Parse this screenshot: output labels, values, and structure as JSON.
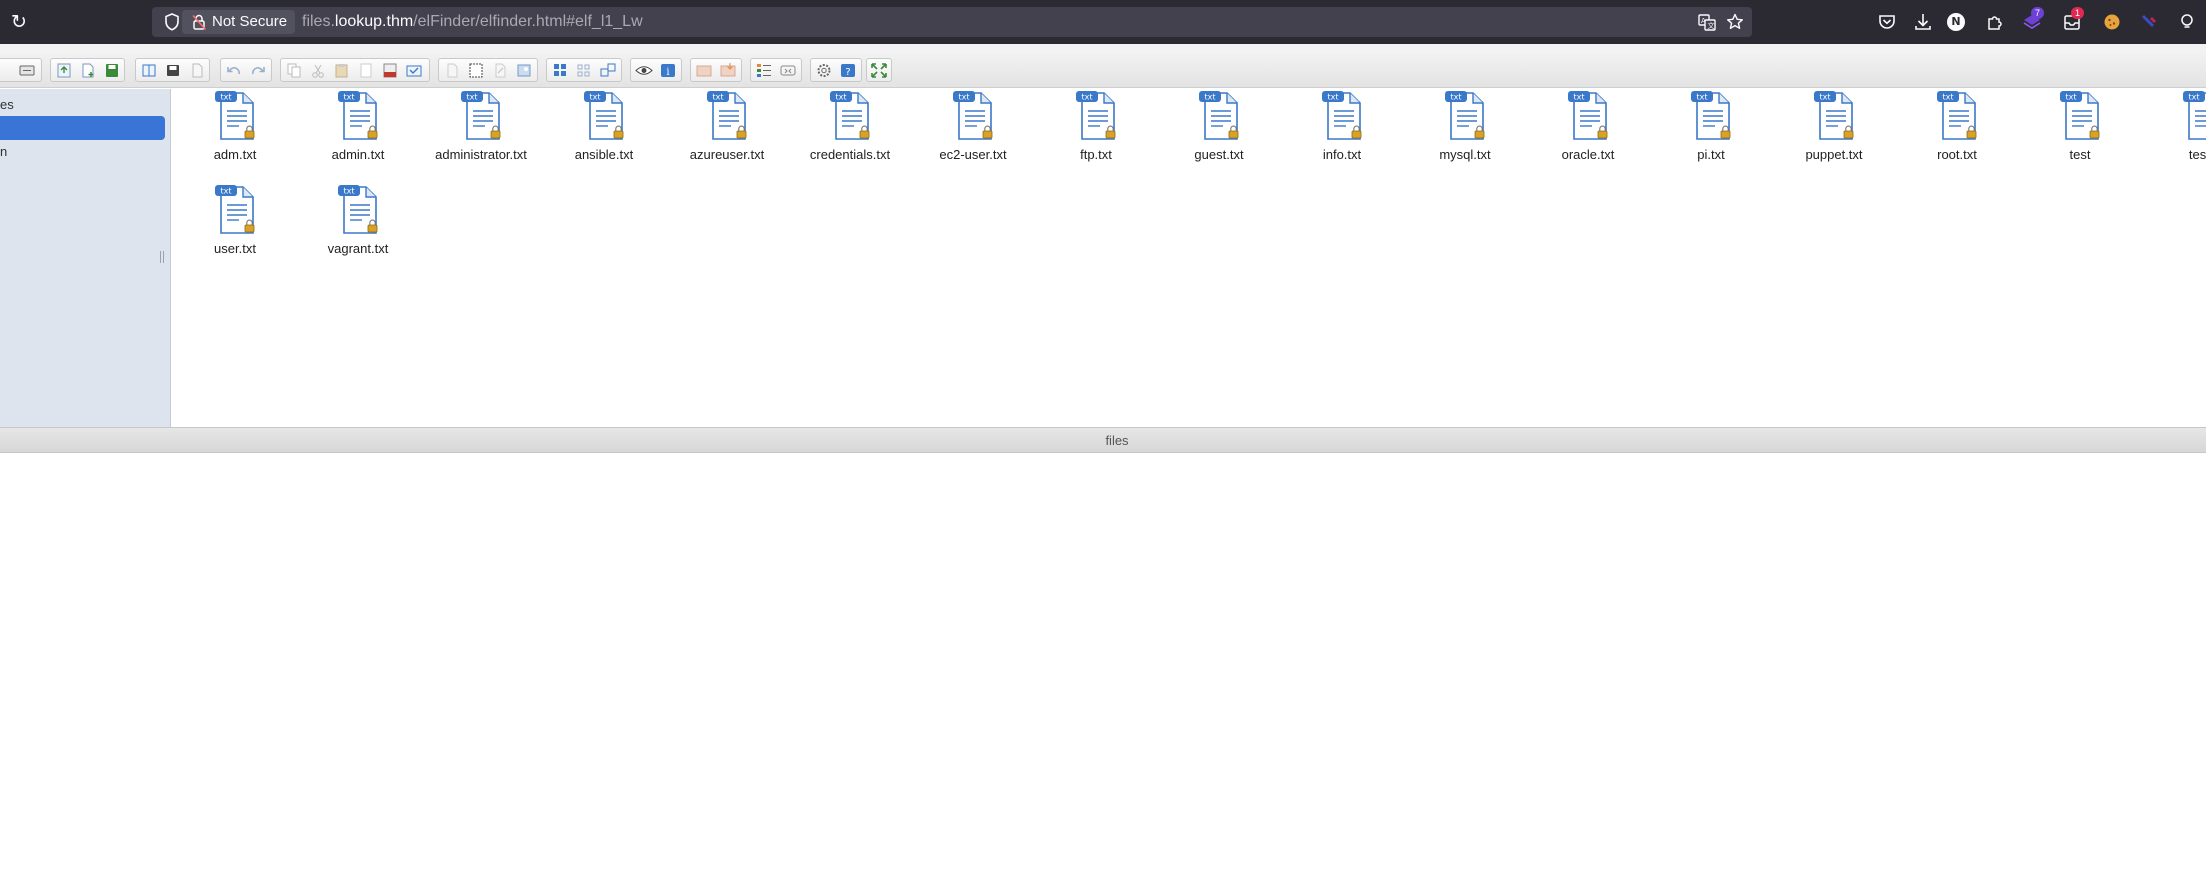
{
  "browser": {
    "security_label": "Not Secure",
    "url_prefix": "files.",
    "url_host": "lookup.thm",
    "url_path": "/elFinder/elfinder.html#elf_l1_Lw",
    "extension_badge_1": "7",
    "extension_badge_2": "1",
    "profile_initial": "N"
  },
  "elfinder": {
    "tree": {
      "root_label": "es",
      "second_label": "n"
    },
    "file_icon_ext": "txt",
    "files": [
      "adm.txt",
      "admin.txt",
      "administrator.txt",
      "ansible.txt",
      "azureuser.txt",
      "credentials.txt",
      "ec2-user.txt",
      "ftp.txt",
      "guest.txt",
      "info.txt",
      "mysql.txt",
      "oracle.txt",
      "pi.txt",
      "puppet.txt",
      "root.txt",
      "test",
      "test.t",
      "user.txt",
      "vagrant.txt"
    ],
    "status_path": "files"
  },
  "colors": {
    "chrome_bg": "#2b2a33",
    "urlbar_bg": "#42414d",
    "tree_selected": "#3875d7",
    "sidebar_bg": "#dde4ed",
    "file_icon_blue": "#3a78c9"
  }
}
